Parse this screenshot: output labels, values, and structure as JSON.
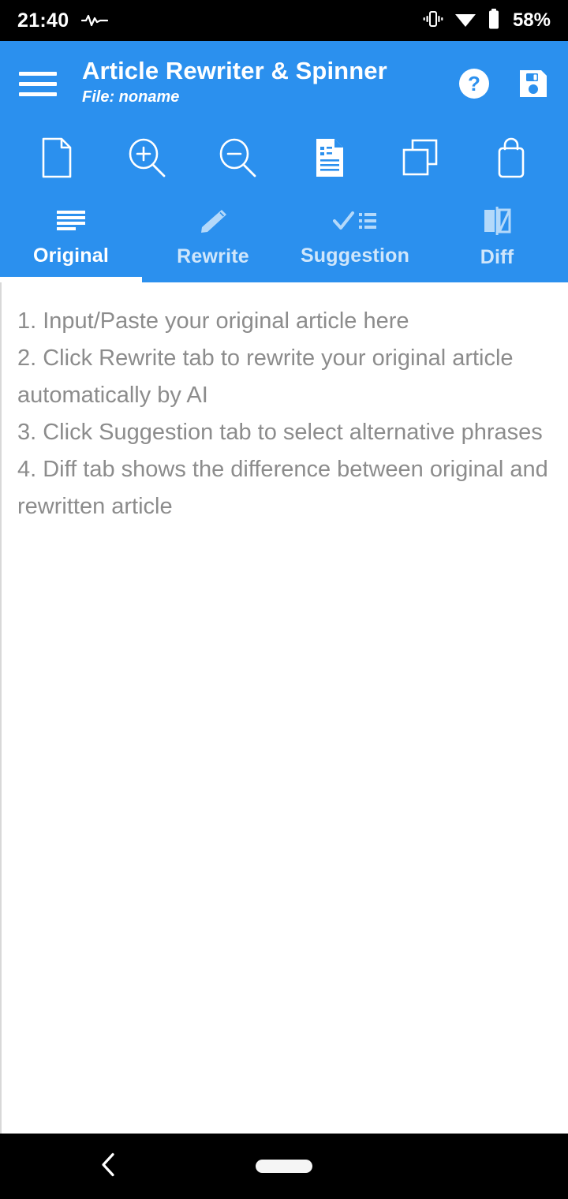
{
  "statusbar": {
    "time": "21:40",
    "pulse_icon": "activity-pulse-icon",
    "vibrate_icon": "vibrate-icon",
    "wifi_icon": "wifi-icon",
    "battery_icon": "battery-icon",
    "battery_text": "58%"
  },
  "appbar": {
    "menu_icon": "hamburger-menu-icon",
    "title": "Article Rewriter & Spinner",
    "subtitle": "File: noname",
    "help_icon": "help-circle-icon",
    "save_icon": "save-floppy-icon",
    "background": "#2b90ee"
  },
  "toolbar": {
    "items": [
      {
        "name": "new-document-icon",
        "label": "New"
      },
      {
        "name": "zoom-in-icon",
        "label": "Zoom In"
      },
      {
        "name": "zoom-out-icon",
        "label": "Zoom Out"
      },
      {
        "name": "article-document-icon",
        "label": "Article"
      },
      {
        "name": "copy-icon",
        "label": "Copy"
      },
      {
        "name": "shopping-bag-icon",
        "label": "Store"
      }
    ]
  },
  "tabs": {
    "active_index": 0,
    "items": [
      {
        "label": "Original",
        "icon": "text-lines-icon"
      },
      {
        "label": "Rewrite",
        "icon": "pencil-edit-icon"
      },
      {
        "label": "Suggestion",
        "icon": "check-list-icon"
      },
      {
        "label": "Diff",
        "icon": "compare-panels-icon"
      }
    ]
  },
  "editor": {
    "value": "",
    "placeholder_lines": [
      "1. Input/Paste your original article here",
      "2. Click Rewrite tab to rewrite your original article automatically by AI",
      "3. Click Suggestion tab to select alternative phrases",
      "4. Diff tab shows the difference between original and rewritten article"
    ],
    "placeholder_color": "#8c8c8c"
  },
  "navbar": {
    "back_icon": "back-chevron-icon",
    "home_icon": "home-pill-icon"
  }
}
